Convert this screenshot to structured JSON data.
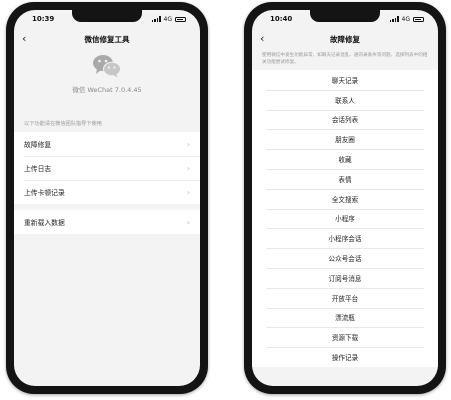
{
  "left_phone": {
    "status_time": "10:39",
    "status_network": "4G",
    "nav_title": "微信修复工具",
    "version_text": "微信 WeChat 7.0.4.45",
    "section_note": "以下功能请在微信团队指导下使用",
    "group1": [
      {
        "label": "故障修复"
      },
      {
        "label": "上传日志"
      },
      {
        "label": "上传卡顿记录"
      }
    ],
    "group2": [
      {
        "label": "重新载入数据"
      }
    ]
  },
  "right_phone": {
    "status_time": "10:40",
    "status_network": "4G",
    "nav_title": "故障修复",
    "intro_text": "使用微信中发生功能异常，如聊天记录混乱、通讯录丢失等问题，选择列表中的相关功能尝试修复。",
    "items": [
      {
        "label": "聊天记录"
      },
      {
        "label": "联系人"
      },
      {
        "label": "会话列表"
      },
      {
        "label": "朋友圈"
      },
      {
        "label": "收藏"
      },
      {
        "label": "表情"
      },
      {
        "label": "全文搜索"
      },
      {
        "label": "小程序"
      },
      {
        "label": "小程序会话"
      },
      {
        "label": "公众号会话"
      },
      {
        "label": "订阅号消息"
      },
      {
        "label": "开放平台"
      },
      {
        "label": "漂流瓶"
      },
      {
        "label": "资源下载"
      },
      {
        "label": "操作记录"
      }
    ]
  },
  "icons": {
    "back": "chevron-left-icon",
    "logo": "wechat-logo-icon",
    "row_arrow": "chevron-right-icon"
  },
  "colors": {
    "screen_background": "#f3f3f3",
    "cell_background": "#ffffff",
    "phone_frame": "#141414"
  }
}
